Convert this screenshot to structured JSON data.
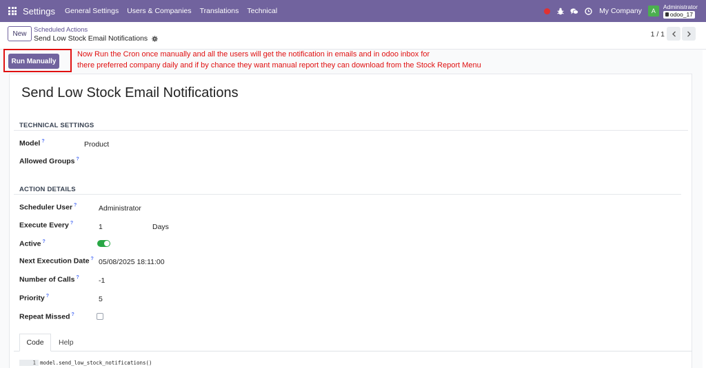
{
  "navbar": {
    "brand": "Settings",
    "menu": [
      "General Settings",
      "Users & Companies",
      "Translations",
      "Technical"
    ],
    "company": "My Company",
    "avatar_letter": "A",
    "user": "Administrator",
    "database": "odoo_17"
  },
  "control": {
    "new_label": "New",
    "breadcrumb_parent": "Scheduled Actions",
    "breadcrumb_current": "Send Low Stock Email Notifications",
    "pager": "1 / 1"
  },
  "action": {
    "run_label": "Run Manually",
    "annotation_line1": "Now Run the Cron once manually and all the users will get the notification in emails and in odoo inbox for",
    "annotation_line2": "there preferred company daily and if by chance they want manual report they can download from the Stock Report Menu",
    "annotation_color": "#e01010"
  },
  "form": {
    "title": "Send Low Stock Email Notifications",
    "technical_section": "TECHNICAL SETTINGS",
    "model_label": "Model",
    "model_value": "Product",
    "groups_label": "Allowed Groups",
    "action_section": "ACTION DETAILS",
    "user_label": "Scheduler User",
    "user_value": "Administrator",
    "every_label": "Execute Every",
    "every_value": "1",
    "every_unit": "Days",
    "active_label": "Active",
    "active_value": true,
    "next_label": "Next Execution Date",
    "next_value": "05/08/2025 18:11:00",
    "calls_label": "Number of Calls",
    "calls_value": "-1",
    "priority_label": "Priority",
    "priority_value": "5",
    "missed_label": "Repeat Missed",
    "missed_value": false,
    "help_mark": "?"
  },
  "tabs": {
    "code": "Code",
    "help": "Help"
  },
  "code": {
    "line_no": "1",
    "line": "model.send_low_stock_notifications()"
  },
  "colors": {
    "brand": "#71639e",
    "toggle_on": "#28a745",
    "help_mark": "#4c6ef5"
  }
}
